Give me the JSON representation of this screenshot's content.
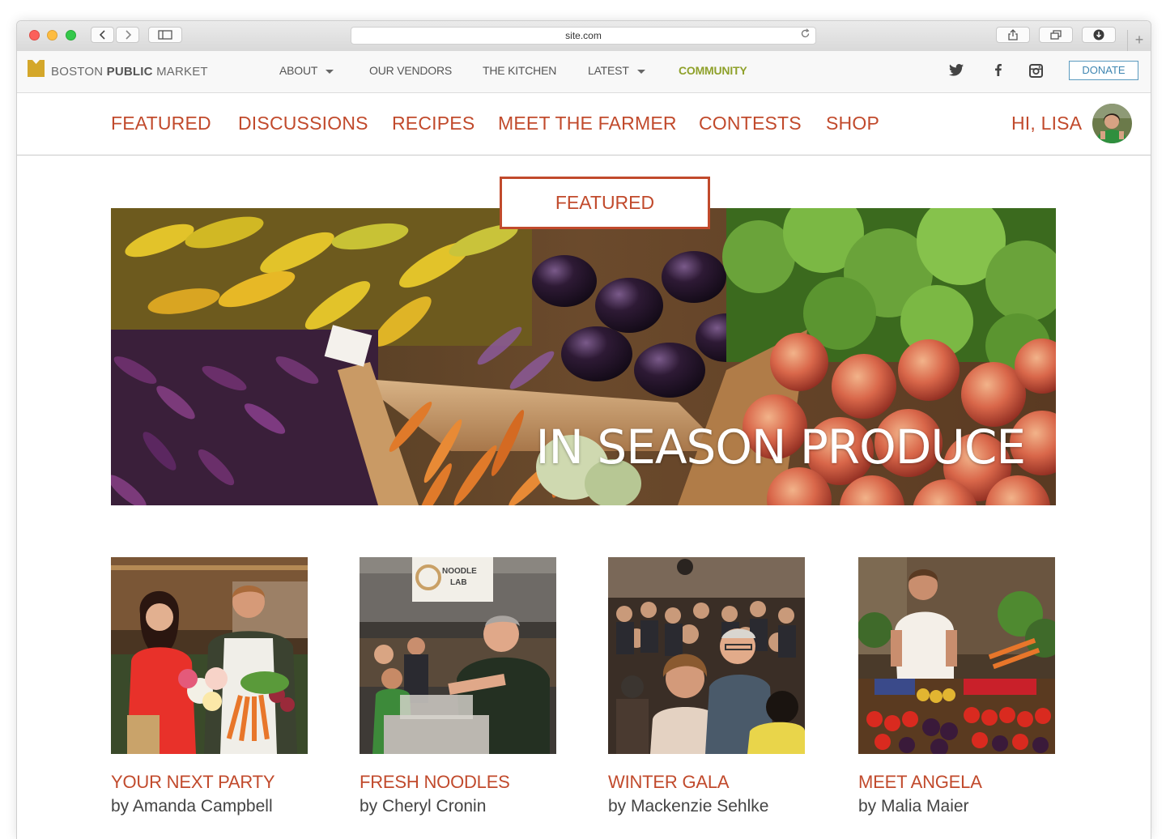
{
  "browser": {
    "url": "site.com"
  },
  "site": {
    "brand_light_1": "BOSTON",
    "brand_bold": "PUBLIC",
    "brand_light_2": "MARKET",
    "nav": {
      "about": "ABOUT",
      "vendors": "OUR VENDORS",
      "kitchen": "THE KITCHEN",
      "latest": "LATEST",
      "community": "COMMUNITY"
    },
    "donate": "DONATE",
    "social_icons": [
      "twitter-icon",
      "facebook-icon",
      "instagram-icon"
    ],
    "colors": {
      "accent": "#c14a2c",
      "active_nav": "#8fa12b",
      "donate": "#3f86b1",
      "logo": "#d4a72a"
    }
  },
  "community_nav": {
    "items": [
      "FEATURED",
      "DISCUSSIONS",
      "RECIPES",
      "MEET THE FARMER",
      "CONTESTS",
      "SHOP"
    ],
    "greeting": "HI, LISA"
  },
  "hero": {
    "badge": "FEATURED",
    "title": "IN SEASON PRODUCE"
  },
  "cards": [
    {
      "title": "YOUR NEXT PARTY",
      "author": "by Amanda Campbell"
    },
    {
      "title": "FRESH NOODLES",
      "author": "by Cheryl Cronin"
    },
    {
      "title": "WINTER GALA",
      "author": "by Mackenzie Sehlke"
    },
    {
      "title": "MEET ANGELA",
      "author": "by Malia Maier"
    }
  ],
  "photo_signs": {
    "noodle_sign_line1": "NOODLE",
    "noodle_sign_line2": "LAB"
  }
}
